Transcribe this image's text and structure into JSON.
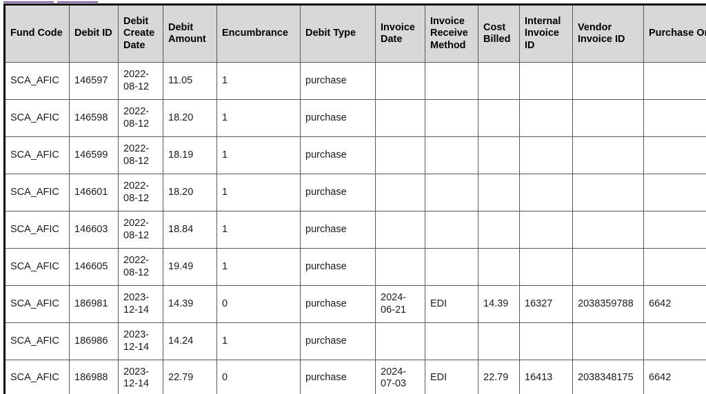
{
  "clipped_links": {
    "accent_color": "#7b4fa8",
    "segments": [
      "",
      ""
    ]
  },
  "table": {
    "columns": [
      {
        "key": "fund_code",
        "label": "Fund Code"
      },
      {
        "key": "debit_id",
        "label": "Debit ID"
      },
      {
        "key": "debit_create_date",
        "label": "Debit Create Date"
      },
      {
        "key": "debit_amount",
        "label": "Debit Amount"
      },
      {
        "key": "encumbrance",
        "label": "Encumbrance"
      },
      {
        "key": "debit_type",
        "label": "Debit Type"
      },
      {
        "key": "invoice_date",
        "label": "Invoice Date"
      },
      {
        "key": "invoice_receive_method",
        "label": "Invoice Receive Method"
      },
      {
        "key": "cost_billed",
        "label": "Cost Billed"
      },
      {
        "key": "internal_invoice_id",
        "label": "Internal Invoice ID"
      },
      {
        "key": "vendor_invoice_id",
        "label": "Vendor Invoice ID"
      },
      {
        "key": "purchase_order_id",
        "label": "Purchase Order ID"
      }
    ],
    "header_background": "#d8d8d8",
    "rows": [
      {
        "fund_code": "SCA_AFIC",
        "debit_id": "146597",
        "debit_create_date": "2022-08-12",
        "debit_amount": "11.05",
        "encumbrance": "1",
        "debit_type": "purchase",
        "invoice_date": "",
        "invoice_receive_method": "",
        "cost_billed": "",
        "internal_invoice_id": "",
        "vendor_invoice_id": "",
        "purchase_order_id": ""
      },
      {
        "fund_code": "SCA_AFIC",
        "debit_id": "146598",
        "debit_create_date": "2022-08-12",
        "debit_amount": "18.20",
        "encumbrance": "1",
        "debit_type": "purchase",
        "invoice_date": "",
        "invoice_receive_method": "",
        "cost_billed": "",
        "internal_invoice_id": "",
        "vendor_invoice_id": "",
        "purchase_order_id": ""
      },
      {
        "fund_code": "SCA_AFIC",
        "debit_id": "146599",
        "debit_create_date": "2022-08-12",
        "debit_amount": "18.19",
        "encumbrance": "1",
        "debit_type": "purchase",
        "invoice_date": "",
        "invoice_receive_method": "",
        "cost_billed": "",
        "internal_invoice_id": "",
        "vendor_invoice_id": "",
        "purchase_order_id": ""
      },
      {
        "fund_code": "SCA_AFIC",
        "debit_id": "146601",
        "debit_create_date": "2022-08-12",
        "debit_amount": "18.20",
        "encumbrance": "1",
        "debit_type": "purchase",
        "invoice_date": "",
        "invoice_receive_method": "",
        "cost_billed": "",
        "internal_invoice_id": "",
        "vendor_invoice_id": "",
        "purchase_order_id": ""
      },
      {
        "fund_code": "SCA_AFIC",
        "debit_id": "146603",
        "debit_create_date": "2022-08-12",
        "debit_amount": "18.84",
        "encumbrance": "1",
        "debit_type": "purchase",
        "invoice_date": "",
        "invoice_receive_method": "",
        "cost_billed": "",
        "internal_invoice_id": "",
        "vendor_invoice_id": "",
        "purchase_order_id": ""
      },
      {
        "fund_code": "SCA_AFIC",
        "debit_id": "146605",
        "debit_create_date": "2022-08-12",
        "debit_amount": "19.49",
        "encumbrance": "1",
        "debit_type": "purchase",
        "invoice_date": "",
        "invoice_receive_method": "",
        "cost_billed": "",
        "internal_invoice_id": "",
        "vendor_invoice_id": "",
        "purchase_order_id": ""
      },
      {
        "fund_code": "SCA_AFIC",
        "debit_id": "186981",
        "debit_create_date": "2023-12-14",
        "debit_amount": "14.39",
        "encumbrance": "0",
        "debit_type": "purchase",
        "invoice_date": "2024-06-21",
        "invoice_receive_method": "EDI",
        "cost_billed": "14.39",
        "internal_invoice_id": "16327",
        "vendor_invoice_id": "2038359788",
        "purchase_order_id": "6642"
      },
      {
        "fund_code": "SCA_AFIC",
        "debit_id": "186986",
        "debit_create_date": "2023-12-14",
        "debit_amount": "14.24",
        "encumbrance": "1",
        "debit_type": "purchase",
        "invoice_date": "",
        "invoice_receive_method": "",
        "cost_billed": "",
        "internal_invoice_id": "",
        "vendor_invoice_id": "",
        "purchase_order_id": ""
      },
      {
        "fund_code": "SCA_AFIC",
        "debit_id": "186988",
        "debit_create_date": "2023-12-14",
        "debit_amount": "22.79",
        "encumbrance": "0",
        "debit_type": "purchase",
        "invoice_date": "2024-07-03",
        "invoice_receive_method": "EDI",
        "cost_billed": "22.79",
        "internal_invoice_id": "16413",
        "vendor_invoice_id": "2038348175",
        "purchase_order_id": "6642"
      }
    ]
  }
}
